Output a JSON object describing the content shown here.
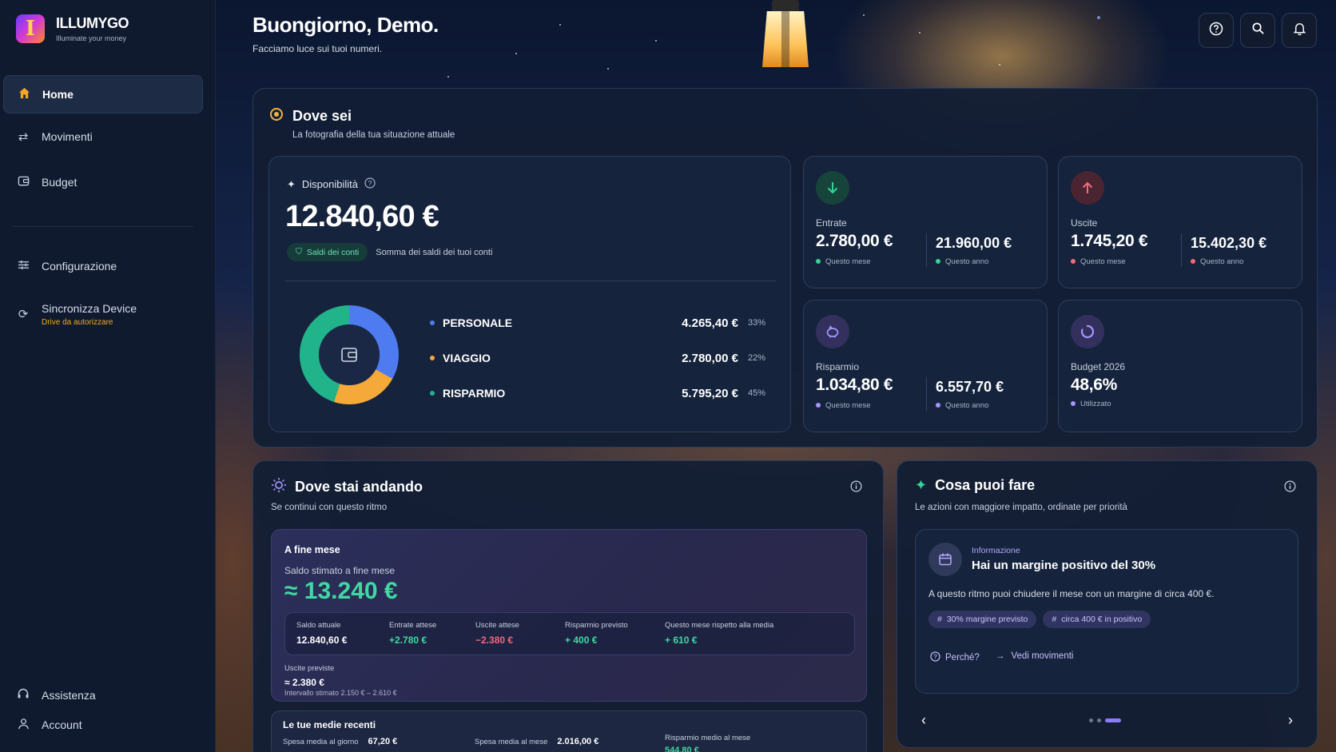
{
  "brand": {
    "name": "ILLUMYGO",
    "tagline": "Illuminate your money",
    "logo_letter": "I"
  },
  "nav": {
    "home": "Home",
    "movimenti": "Movimenti",
    "budget": "Budget",
    "configurazione": "Configurazione",
    "sync": "Sincronizza Device",
    "sync_sub": "Drive da autorizzare",
    "assistenza": "Assistenza",
    "account": "Account"
  },
  "header": {
    "greeting": "Buongiorno, Demo.",
    "subtitle": "Facciamo luce sui tuoi numeri."
  },
  "dove_sei": {
    "title": "Dove sei",
    "subtitle": "La fotografia della tua situazione attuale",
    "disponibilita_label": "Disponibilità",
    "total": "12.840,60 €",
    "badge": "Saldi dei conti",
    "badge_note": "Somma dei saldi dei tuoi conti",
    "accounts": [
      {
        "name": "PERSONALE",
        "amount": "4.265,40 €",
        "pct": "33%",
        "share": 33,
        "color": "#4f7bf0"
      },
      {
        "name": "VIAGGIO",
        "amount": "2.780,00 €",
        "pct": "22%",
        "share": 22,
        "color": "#f5a938"
      },
      {
        "name": "RISPARMIO",
        "amount": "5.795,20 €",
        "pct": "45%",
        "share": 45,
        "color": "#21b38a"
      }
    ]
  },
  "kpi": {
    "entrate": {
      "label": "Entrate",
      "month": "2.780,00 €",
      "year": "21.960,00 €",
      "month_label": "Questo mese",
      "year_label": "Questo anno"
    },
    "uscite": {
      "label": "Uscite",
      "month": "1.745,20 €",
      "year": "15.402,30 €",
      "month_label": "Questo mese",
      "year_label": "Questo anno"
    },
    "risparmio": {
      "label": "Risparmio",
      "month": "1.034,80 €",
      "year": "6.557,70 €",
      "month_label": "Questo mese",
      "year_label": "Questo anno"
    },
    "budget": {
      "label": "Budget 2026",
      "value": "48,6%",
      "value_label": "Utilizzato"
    }
  },
  "dove_vai": {
    "title": "Dove stai andando",
    "subtitle": "Se continui con questo ritmo",
    "box_title": "A fine mese",
    "saldo_label": "Saldo stimato a fine mese",
    "saldo_value": "≈ 13.240 €",
    "cols": [
      {
        "label": "Saldo attuale",
        "value": "12.840,60 €",
        "tone": "white"
      },
      {
        "label": "Entrate attese",
        "value": "+2.780 €",
        "tone": "green"
      },
      {
        "label": "Uscite attese",
        "value": "−2.380 €",
        "tone": "red"
      },
      {
        "label": "Risparmio previsto",
        "value": "+ 400 €",
        "tone": "green"
      },
      {
        "label": "Questo mese rispetto alla media",
        "value": "+ 610 €",
        "tone": "green"
      }
    ],
    "uscite_label": "Uscite previste",
    "uscite_value": "≈ 2.380 €",
    "intervallo": "Intervallo stimato 2.150 € – 2.610 €",
    "medie_title": "Le tue medie recenti",
    "medie": [
      {
        "label": "Spesa media al giorno",
        "value": "67,20 €"
      },
      {
        "label": "Spesa media al mese",
        "value": "2.016,00 €"
      },
      {
        "label": "Risparmio medio al mese",
        "value": "544,80 €"
      }
    ]
  },
  "cosa_fare": {
    "title": "Cosa puoi fare",
    "subtitle": "Le azioni con maggiore impatto, ordinate per priorità",
    "tag": "Informazione",
    "headline": "Hai un margine positivo del 30%",
    "body": "A questo ritmo puoi chiudere il mese con un margine di circa 400 €.",
    "chip1": "30% margine previsto",
    "chip2": "circa 400 € in positivo",
    "why": "Perché?",
    "link": "Vedi movimenti"
  }
}
